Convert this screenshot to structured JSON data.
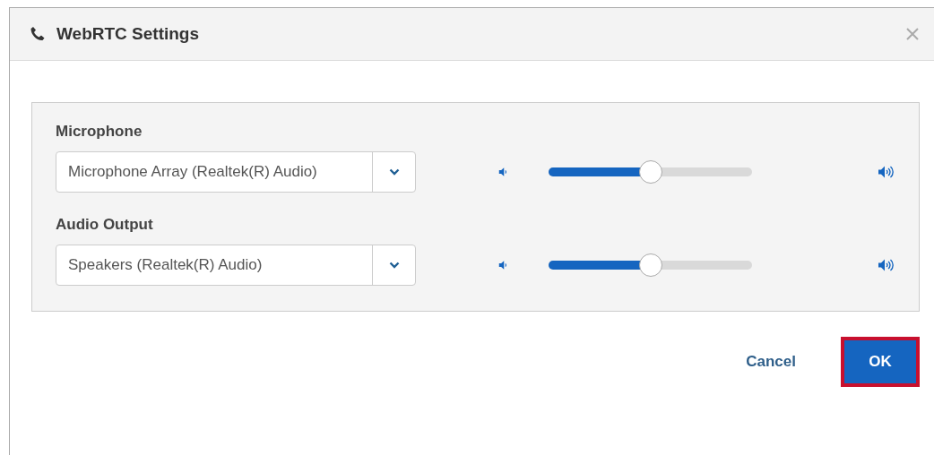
{
  "window": {
    "title": "WebRTC Settings"
  },
  "devices": [
    {
      "label": "Microphone",
      "value": "Microphone Array (Realtek(R) Audio)",
      "level": 0.5
    },
    {
      "label": "Audio Output",
      "value": "Speakers (Realtek(R) Audio)",
      "level": 0.5
    }
  ],
  "buttons": [
    {
      "label": "Cancel",
      "kind": "link",
      "highlighted": false
    },
    {
      "label": "OK",
      "kind": "primary",
      "highlighted": true
    }
  ]
}
